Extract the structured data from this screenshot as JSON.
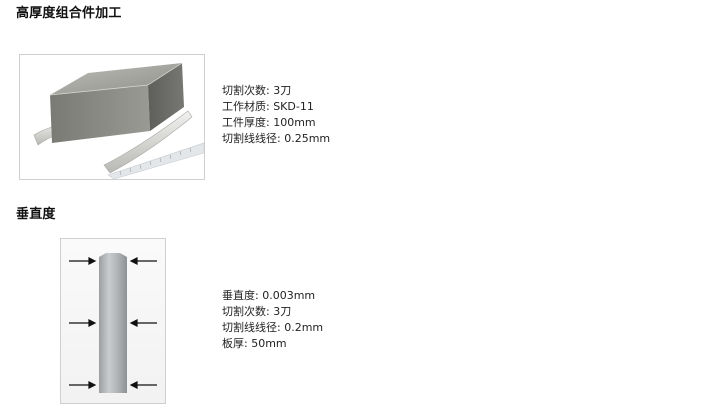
{
  "section1": {
    "title": "高厚度组合件加工",
    "specs": [
      "切割次数: 3刀",
      "工作材质: SKD-11",
      "工件厚度: 100mm",
      "切割线线径: 0.25mm"
    ]
  },
  "section2": {
    "title": "垂直度",
    "specs": [
      "垂直度: 0.003mm",
      "切割次数: 3刀",
      "切割线线径: 0.2mm",
      "板厚: 50mm"
    ]
  }
}
